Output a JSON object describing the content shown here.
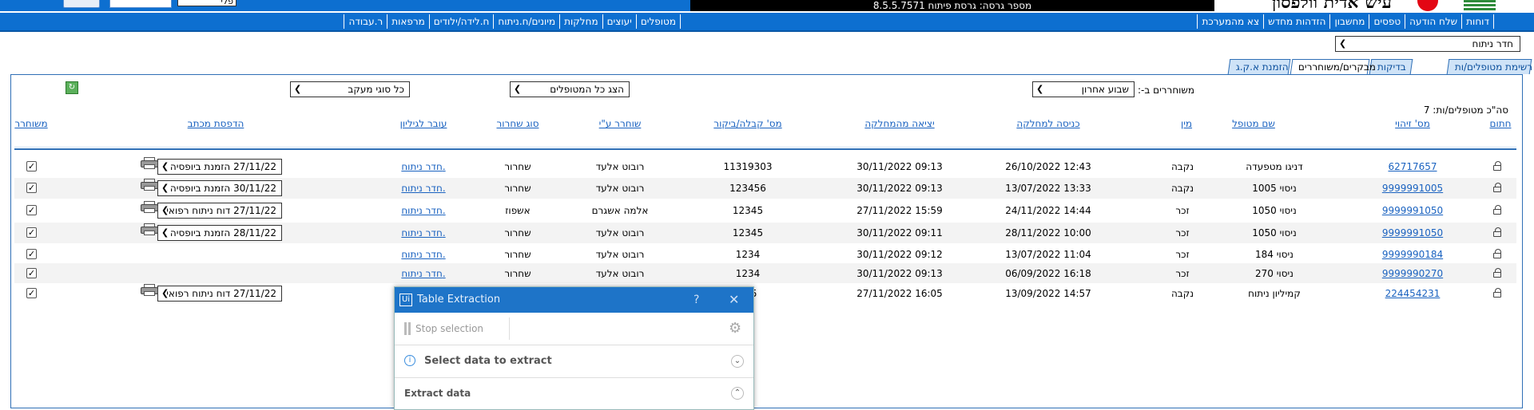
{
  "topbar": {
    "version_text": "מספר גרסה: גרסת פיתוח 8.5.5.7571",
    "logo_text": "עיש אדית וולפסון",
    "select_value": "פלי"
  },
  "menu": {
    "right_items": [
      "דוחות",
      "שלח הודעה",
      "טפסים",
      "מחשבון",
      "הזדהות מחדש",
      "צא מהמערכת"
    ],
    "left_items": [
      "מטופלים",
      "יעוצים",
      "מחלקות",
      "מיונים/ח.ניתוח",
      "ח.לידה/ילודים",
      "מרפאות",
      "ר.עבודה"
    ]
  },
  "room_select": {
    "value": "חדר ניתוח"
  },
  "tabs": [
    "רשימת מטופלים/ות",
    "בדיקות",
    "מבקרים/משוחררים",
    "הזמנת א.ק.ג"
  ],
  "active_tab": "מבקרים/משוחררים",
  "filters": {
    "released_label": "משוחררים ב-:",
    "released_value": "שבוע אחרון",
    "patients_value": "הצג כל המטופלים",
    "followup_value": "כל סוגי מעקב"
  },
  "total_text": "סה\"כ מטופלים/ות: 7",
  "columns": {
    "lock": "חתום",
    "id": "מס' זיהוי",
    "name": "שם מטופל",
    "gender": "מין",
    "admit": "כניסה למחלקה",
    "exit": "יציאה מהמחלקה",
    "visit": "מס' קבלה/ביקור",
    "released_by": "שוחרר ע\"י",
    "release_type": "סוג שחרור",
    "moved": "עובר לגיליון",
    "print": "הדפסת מכתב",
    "released": "משוחרר"
  },
  "rows": [
    {
      "id": "62717657",
      "name": "דניגו מטפעדה",
      "gender": "נקבה",
      "admit": "26/10/2022 12:43",
      "exit": "30/11/2022 09:13",
      "visit": "11319303",
      "released_by": "רובוט אלעד",
      "release_type": "שחרור",
      "moved": "חדר ניתוח.",
      "print": "27/11/22 הזמנת ביופסיה",
      "checked": "✓",
      "has_print": true
    },
    {
      "id": "9999991005",
      "name": "ניסוי 1005",
      "gender": "נקבה",
      "admit": "13/07/2022 13:33",
      "exit": "30/11/2022 09:13",
      "visit": "123456",
      "released_by": "רובוט אלעד",
      "release_type": "שחרור",
      "moved": "חדר ניתוח.",
      "print": "30/11/22 הזמנת ביופסיה",
      "checked": "✓",
      "has_print": true
    },
    {
      "id": "9999991050",
      "name": "ניסוי 1050",
      "gender": "זכר",
      "admit": "24/11/2022 14:44",
      "exit": "27/11/2022 15:59",
      "visit": "12345",
      "released_by": "אלמה אשגרם",
      "release_type": "אשפוז",
      "moved": "חדר ניתוח.",
      "print": "27/11/22 דוח ניתוח רפואי",
      "checked": "✓",
      "has_print": true
    },
    {
      "id": "9999991050",
      "name": "ניסוי 1050",
      "gender": "זכר",
      "admit": "28/11/2022 10:00",
      "exit": "30/11/2022 09:11",
      "visit": "12345",
      "released_by": "רובוט אלעד",
      "release_type": "שחרור",
      "moved": "חדר ניתוח.",
      "print": "28/11/22 הזמנת ביופסיה",
      "checked": "✓",
      "has_print": true
    },
    {
      "id": "9999990184",
      "name": "ניסוי 184",
      "gender": "זכר",
      "admit": "13/07/2022 11:04",
      "exit": "30/11/2022 09:12",
      "visit": "1234",
      "released_by": "רובוט אלעד",
      "release_type": "שחרור",
      "moved": "חדר ניתוח.",
      "print": "",
      "checked": "✓",
      "has_print": false
    },
    {
      "id": "9999990270",
      "name": "ניסוי 270",
      "gender": "זכר",
      "admit": "06/09/2022 16:18",
      "exit": "30/11/2022 09:13",
      "visit": "1234",
      "released_by": "רובוט אלעד",
      "release_type": "שחרור",
      "moved": "חדר ניתוח.",
      "print": "",
      "checked": "✓",
      "has_print": false
    },
    {
      "id": "224454231",
      "name": "קמיליון ניתוח",
      "gender": "נקבה",
      "admit": "13/09/2022 14:57",
      "exit": "27/11/2022 16:05",
      "visit": "335",
      "released_by": "",
      "release_type": "",
      "moved": "",
      "print": "27/11/22 דוח ניתוח רפואי",
      "checked": "✓",
      "has_print": true
    }
  ],
  "dialog": {
    "title": "Table Extraction",
    "logo": "Ui",
    "help": "?",
    "close": "✕",
    "stop_label": "Stop selection",
    "select_label": "Select data to extract",
    "extract_label": "Extract data"
  }
}
